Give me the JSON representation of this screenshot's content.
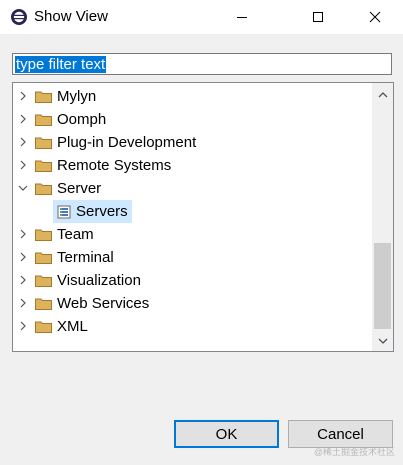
{
  "window": {
    "title": "Show View",
    "controls": {
      "minimize": "minimize",
      "maximize": "maximize",
      "close": "close"
    }
  },
  "filter": {
    "value": "type filter text",
    "placeholder": "type filter text"
  },
  "tree": {
    "items": [
      {
        "label": "Mylyn",
        "expanded": false
      },
      {
        "label": "Oomph",
        "expanded": false
      },
      {
        "label": "Plug-in Development",
        "expanded": false
      },
      {
        "label": "Remote Systems",
        "expanded": false
      },
      {
        "label": "Server",
        "expanded": true,
        "children": [
          {
            "label": "Servers",
            "selected": true
          }
        ]
      },
      {
        "label": "Team",
        "expanded": false
      },
      {
        "label": "Terminal",
        "expanded": false
      },
      {
        "label": "Visualization",
        "expanded": false
      },
      {
        "label": "Web Services",
        "expanded": false
      },
      {
        "label": "XML",
        "expanded": false
      }
    ]
  },
  "buttons": {
    "ok": "OK",
    "cancel": "Cancel"
  },
  "watermark": "@稀土掘金技术社区",
  "colors": {
    "selection": "#0078d7",
    "tree_selection": "#cde8ff",
    "folder": "#dcb35c",
    "window_bg": "#f0f0f0"
  }
}
